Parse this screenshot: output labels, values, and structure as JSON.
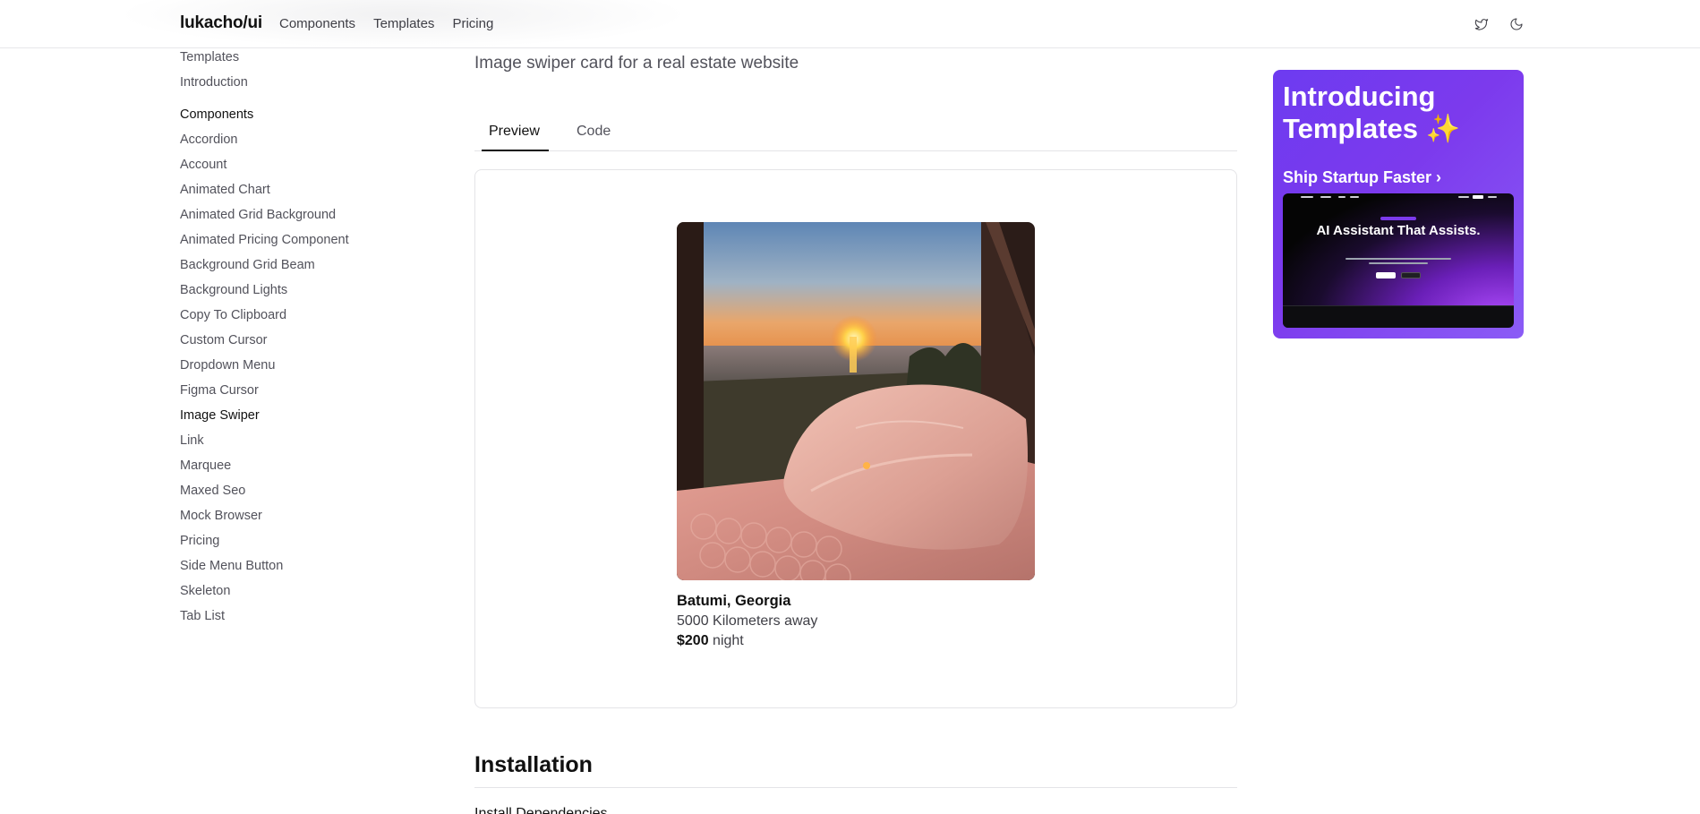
{
  "header": {
    "logo": "lukacho/ui",
    "nav": [
      "Components",
      "Templates",
      "Pricing"
    ],
    "icons": [
      "twitter-icon",
      "moon-icon"
    ]
  },
  "sidebar": {
    "top_items": [
      "Templates",
      "Introduction"
    ],
    "components_heading": "Components",
    "items": [
      "Accordion",
      "Account",
      "Animated Chart",
      "Animated Grid Background",
      "Animated Pricing Component",
      "Background Grid Beam",
      "Background Lights",
      "Copy To Clipboard",
      "Custom Cursor",
      "Dropdown Menu",
      "Figma Cursor",
      "Image Swiper",
      "Link",
      "Marquee",
      "Maxed Seo",
      "Mock Browser",
      "Pricing",
      "Side Menu Button",
      "Skeleton",
      "Tab List"
    ],
    "active": "Image Swiper"
  },
  "main": {
    "subtitle": "Image swiper card for a real estate website",
    "tabs": [
      "Preview",
      "Code"
    ],
    "active_tab": "Preview",
    "card": {
      "location": "Batumi, Georgia",
      "distance": "5000 Kilometers away",
      "price": "$200",
      "price_unit": "night"
    },
    "installation_heading": "Installation",
    "installation_subheading": "Install Dependencies"
  },
  "promo": {
    "title": "Introducing Templates ✨",
    "link": "Ship Startup Faster",
    "chevron": "›",
    "screenshot_headline": "AI Assistant That Assists."
  },
  "colors": {
    "promo_purple": "#7c3aed",
    "text_primary": "#111111",
    "text_muted": "#52525b",
    "border": "#e4e4e7"
  }
}
